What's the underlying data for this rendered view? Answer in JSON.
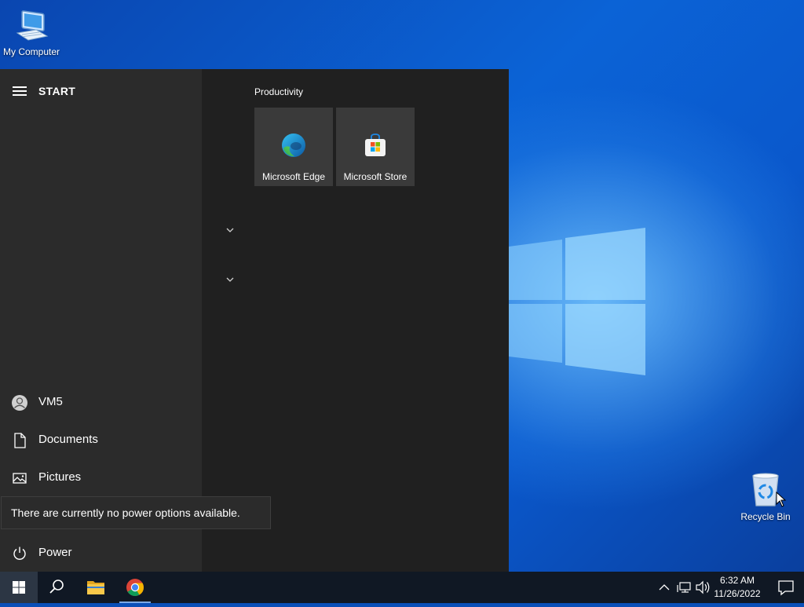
{
  "desktop": {
    "icons": [
      {
        "label": "My Computer",
        "icon": "computer-icon"
      },
      {
        "label": "Recycle Bin",
        "icon": "recycle-bin-icon"
      }
    ]
  },
  "start_menu": {
    "title": "START",
    "left_items": [
      {
        "label": "VM5",
        "icon": "user-icon"
      },
      {
        "label": "Documents",
        "icon": "document-icon"
      },
      {
        "label": "Pictures",
        "icon": "pictures-icon"
      },
      {
        "label": "Power",
        "icon": "power-icon"
      }
    ],
    "tooltip": "There are currently no power options available.",
    "tile_group": {
      "title": "Productivity",
      "tiles": [
        {
          "label": "Microsoft Edge",
          "icon": "edge-icon"
        },
        {
          "label": "Microsoft Store",
          "icon": "store-icon"
        }
      ]
    }
  },
  "taskbar": {
    "pinned": [
      "windows-start-icon",
      "search-icon",
      "file-explorer-icon",
      "chrome-icon"
    ],
    "clock": {
      "time": "6:32 AM",
      "date": "11/26/2022"
    }
  },
  "colors": {
    "accent": "#0a63d6",
    "menu_background": "#202020",
    "menu_left_background": "#2b2b2b",
    "tile_background": "#3a3a3a",
    "taskbar_background": "#101824"
  }
}
